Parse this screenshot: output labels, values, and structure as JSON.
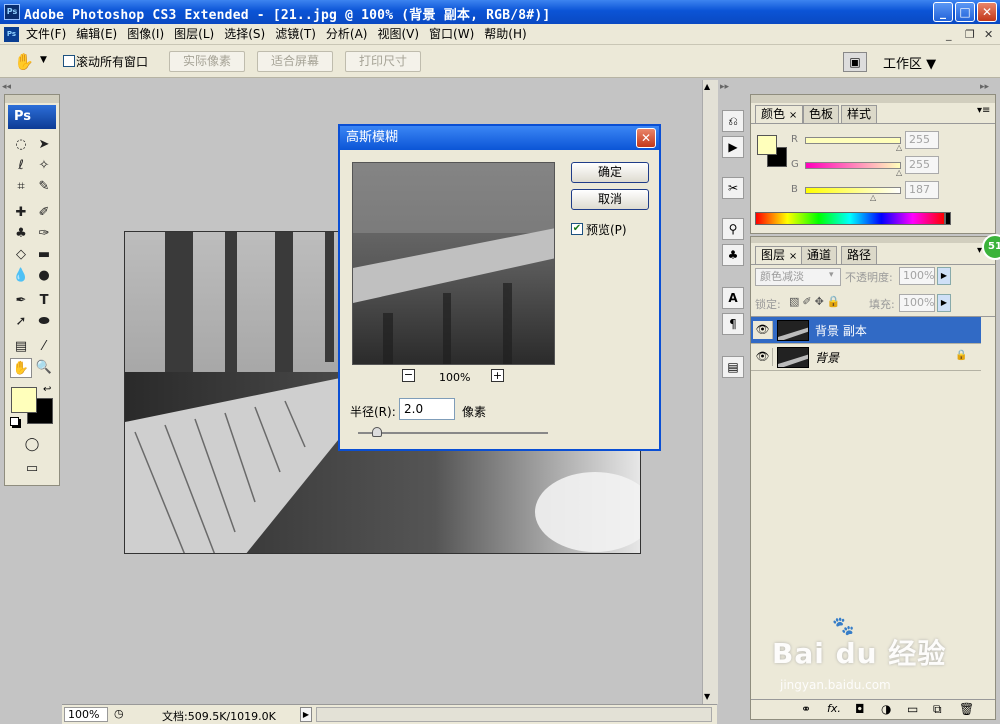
{
  "window": {
    "title": "Adobe Photoshop CS3 Extended - [21..jpg @ 100% (背景 副本, RGB/8#)]",
    "icon": "ps-icon",
    "min": "_",
    "max": "□",
    "close": "✕"
  },
  "menu": {
    "items": [
      "文件(F)",
      "编辑(E)",
      "图像(I)",
      "图层(L)",
      "选择(S)",
      "滤镜(T)",
      "分析(A)",
      "视图(V)",
      "窗口(W)",
      "帮助(H)"
    ],
    "doc_min": "_",
    "doc_restore": "❐",
    "doc_close": "✕"
  },
  "options": {
    "scroll_all": "滚动所有窗口",
    "actual_pixels": "实际像素",
    "fit_screen": "适合屏幕",
    "print_size": "打印尺寸",
    "workspace": "工作区 ▼"
  },
  "tools": {
    "logo": "Ps"
  },
  "dialog": {
    "title": "高斯模糊",
    "ok": "确定",
    "cancel": "取消",
    "preview": "预览(P)",
    "zoom": "100%",
    "zoom_out": "−",
    "zoom_in": "+",
    "radius_label": "半径(R):",
    "radius_value": "2.0",
    "radius_unit": "像素",
    "slider_fraction": 0.1
  },
  "color_panel": {
    "tabs": [
      "颜色",
      "色板",
      "样式"
    ],
    "close": "×",
    "r_label": "R",
    "g_label": "G",
    "b_label": "B",
    "r": "255",
    "g": "255",
    "b": "187",
    "fg": "#ffffbb",
    "bg": "#000000"
  },
  "layers_panel": {
    "tabs": [
      "图层",
      "通道",
      "路径"
    ],
    "close": "×",
    "blend_mode": "颜色减淡",
    "opacity_label": "不透明度:",
    "opacity": "100%",
    "lock_label": "锁定:",
    "fill_label": "填充:",
    "fill": "100%",
    "layers": [
      {
        "name": "背景 副本",
        "selected": true
      },
      {
        "name": "背景",
        "selected": false
      }
    ],
    "bottom_icons": [
      "link-icon",
      "fx-icon",
      "mask-icon",
      "adjustment-icon",
      "group-icon",
      "new-layer-icon",
      "trash-icon"
    ],
    "fx": "fx."
  },
  "status": {
    "zoom": "100%",
    "doc": "文档:509.5K/1019.0K"
  },
  "watermark": {
    "brand": "Bai du 经验",
    "url": "jingyan.baidu.com"
  },
  "badge": "51"
}
